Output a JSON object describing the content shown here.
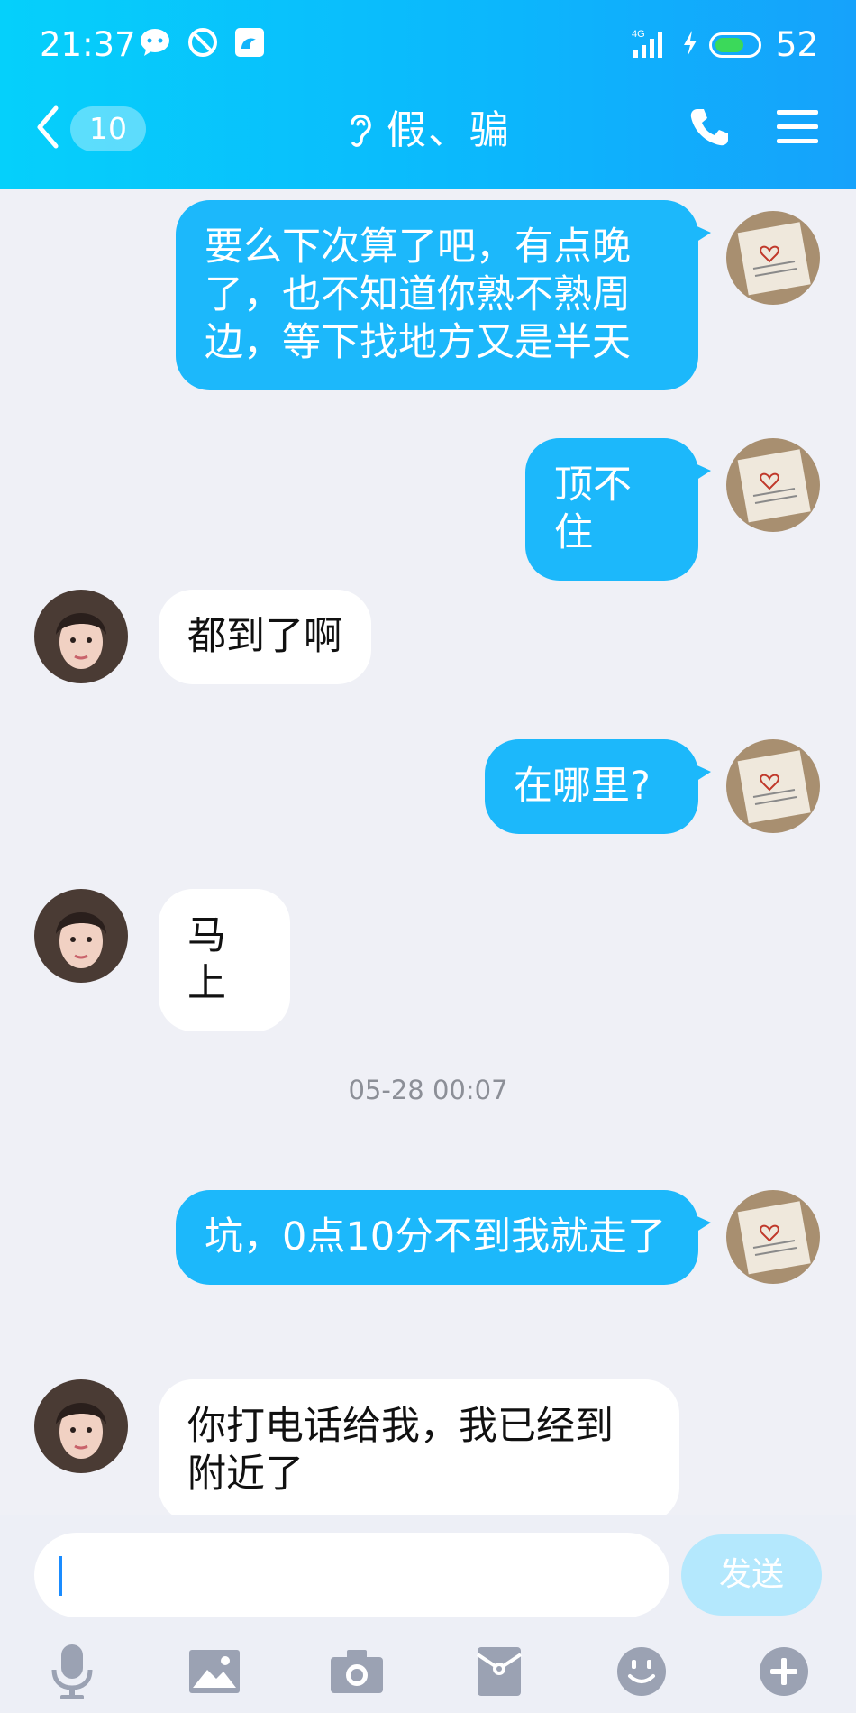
{
  "status_bar": {
    "time": "21:37",
    "network": "4G",
    "battery": "52"
  },
  "header": {
    "unread_count": "10",
    "title": "假、骗"
  },
  "messages": [
    {
      "side": "out",
      "text": "要么下次算了吧，有点晚了，也不知道你熟不熟周边，等下找地方又是半天"
    },
    {
      "side": "out",
      "text": "顶不住"
    },
    {
      "side": "in",
      "text": "都到了啊"
    },
    {
      "side": "out",
      "text": "在哪里?"
    },
    {
      "side": "in",
      "text": "马上"
    },
    {
      "type": "time",
      "text": "05-28 00:07"
    },
    {
      "side": "out",
      "text": "坑，0点10分不到我就走了"
    },
    {
      "side": "in",
      "text": "你打电话给我，我已经到附近了"
    }
  ],
  "input": {
    "value": "",
    "send_label": "发送"
  },
  "toolbar_icons": [
    "mic-icon",
    "image-icon",
    "camera-icon",
    "red-packet-icon",
    "emoji-icon",
    "plus-icon"
  ],
  "colors": {
    "header": "#0cb6fc",
    "outgoing_bubble": "#1cb8fb",
    "incoming_bubble": "#ffffff",
    "background": "#eff0f6",
    "send_button": "#b4e8fd"
  }
}
